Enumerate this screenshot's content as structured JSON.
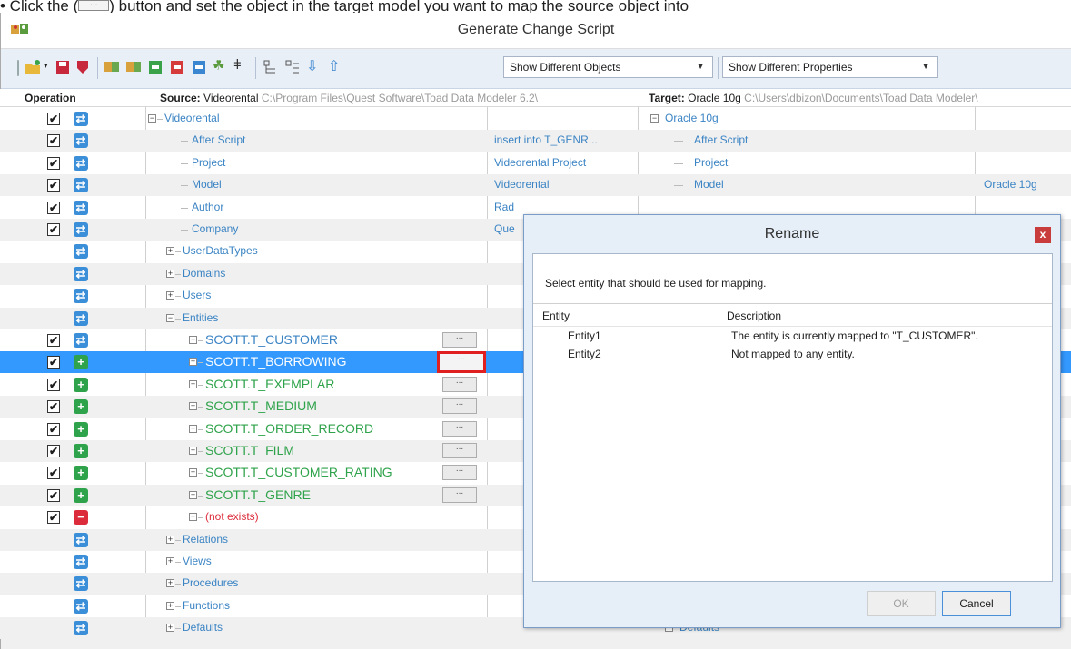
{
  "instruction": {
    "prefix": "•  Click the (",
    "button_glyph": "...",
    "suffix": ") button and set the object in the target model you want to map the source object into"
  },
  "window": {
    "title": "Generate Change Script"
  },
  "toolbar": {
    "objects_filter": "Show Different Objects",
    "properties_filter": "Show Different Properties"
  },
  "grid": {
    "operation_header": "Operation",
    "source_label": "Source:",
    "source_name": "Videorental",
    "source_path": "C:\\Program Files\\Quest Software\\Toad Data Modeler 6.2\\",
    "target_label": "Target:",
    "target_name": "Oracle 10g",
    "target_path": "C:\\Users\\dbizon\\Documents\\Toad Data Modeler\\",
    "rows": [
      {
        "label": "Videorental",
        "value": "",
        "target": "Oracle 10g",
        "target_value": ""
      },
      {
        "label": "After Script",
        "value": "insert into T_GENR...",
        "target": "After Script",
        "target_value": ""
      },
      {
        "label": "Project",
        "value": "Videorental Project",
        "target": "Project",
        "target_value": ""
      },
      {
        "label": "Model",
        "value": "Videorental",
        "target": "Model",
        "target_value": "Oracle 10g"
      },
      {
        "label": "Author",
        "value": "Rad",
        "target": "",
        "target_value": ""
      },
      {
        "label": "Company",
        "value": "Que",
        "target": "",
        "target_value": ""
      },
      {
        "label": "UserDataTypes"
      },
      {
        "label": "Domains"
      },
      {
        "label": "Users"
      },
      {
        "label": "Entities"
      },
      {
        "label": "SCOTT.T_CUSTOMER"
      },
      {
        "label": "SCOTT.T_BORROWING"
      },
      {
        "label": "SCOTT.T_EXEMPLAR"
      },
      {
        "label": "SCOTT.T_MEDIUM"
      },
      {
        "label": "SCOTT.T_ORDER_RECORD"
      },
      {
        "label": "SCOTT.T_FILM"
      },
      {
        "label": "SCOTT.T_CUSTOMER_RATING"
      },
      {
        "label": "SCOTT.T_GENRE"
      },
      {
        "label": "(not exists)"
      },
      {
        "label": "Relations"
      },
      {
        "label": "Views"
      },
      {
        "label": "Procedures"
      },
      {
        "label": "Functions"
      },
      {
        "label": "Defaults",
        "target": "Defaults"
      }
    ],
    "map_button_glyph": "..."
  },
  "dialog": {
    "title": "Rename",
    "close_glyph": "x",
    "message": "Select entity that should be used for mapping.",
    "col_entity": "Entity",
    "col_description": "Description",
    "items": [
      {
        "entity": "Entity1",
        "description": "The entity is currently mapped to \"T_CUSTOMER\"."
      },
      {
        "entity": "Entity2",
        "description": "Not mapped to any entity."
      }
    ],
    "ok_label": "OK",
    "cancel_label": "Cancel"
  },
  "icons": {
    "update": "update-icon",
    "add": "add-icon",
    "delete": "delete-icon"
  }
}
